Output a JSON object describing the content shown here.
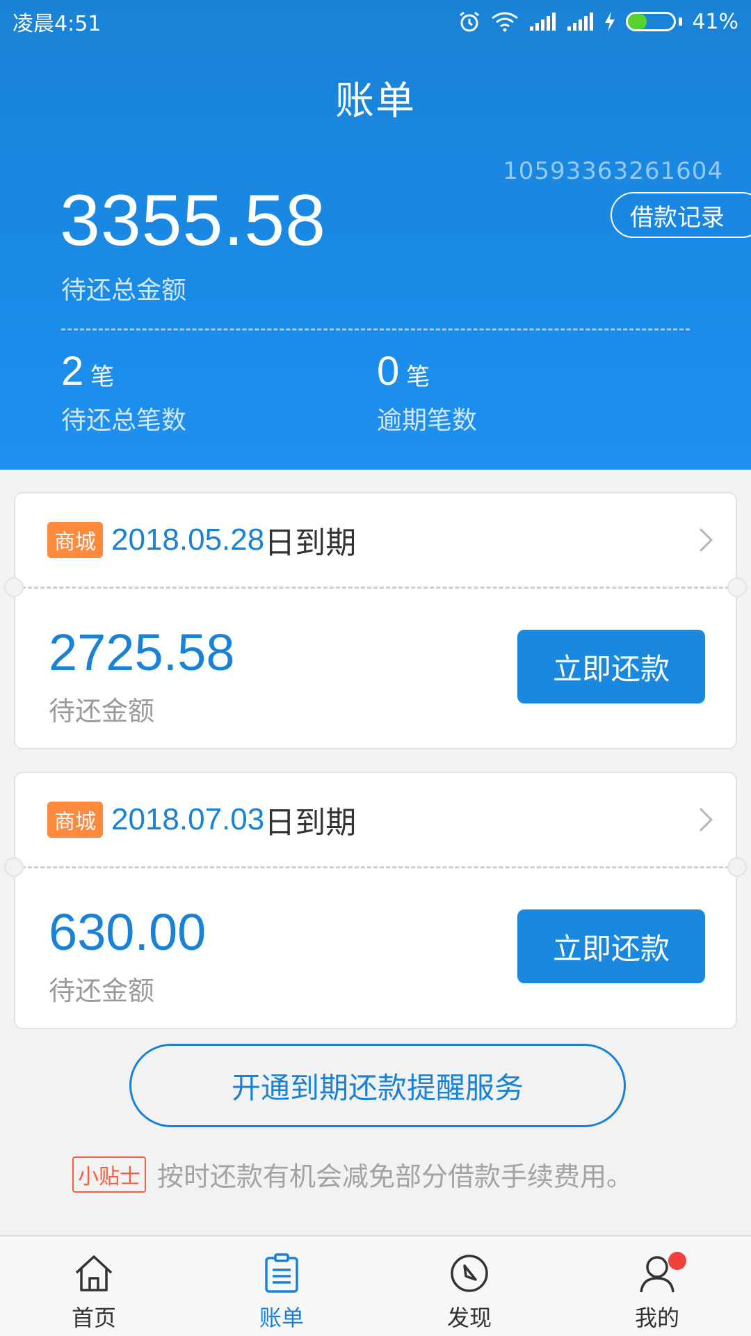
{
  "status_bar": {
    "time": "凌晨4:51",
    "battery": "41%",
    "battery_level": 0.41,
    "icons": [
      "alarm-icon",
      "wifi-icon",
      "signal-icon",
      "signal-icon",
      "charging-icon",
      "battery-icon"
    ]
  },
  "header": {
    "title": "账单",
    "account_no": "10593363261604",
    "record_button": "借款记录",
    "total_amount": "3355.58",
    "total_label": "待还总金额",
    "stats": [
      {
        "value": "2",
        "unit": "笔",
        "label": "待还总笔数"
      },
      {
        "value": "0",
        "unit": "笔",
        "label": "逾期笔数"
      }
    ]
  },
  "bills": [
    {
      "tag": "商城",
      "date": "2018.05.28",
      "date_suffix": "日到期",
      "amount": "2725.58",
      "amount_label": "待还金额",
      "pay_button": "立即还款"
    },
    {
      "tag": "商城",
      "date": "2018.07.03",
      "date_suffix": "日到期",
      "amount": "630.00",
      "amount_label": "待还金额",
      "pay_button": "立即还款"
    }
  ],
  "reminder_button": "开通到期还款提醒服务",
  "tip": {
    "tag": "小贴士",
    "text": "按时还款有机会减免部分借款手续费用。"
  },
  "nav": {
    "active": 1,
    "items": [
      {
        "label": "首页",
        "icon": "home-icon"
      },
      {
        "label": "账单",
        "icon": "bill-icon"
      },
      {
        "label": "发现",
        "icon": "compass-icon"
      },
      {
        "label": "我的",
        "icon": "user-icon"
      }
    ]
  },
  "colors": {
    "primary": "#1a82d6",
    "tag": "#ff8a3d",
    "tip": "#ff5a3a",
    "badge": "#f0403a"
  }
}
